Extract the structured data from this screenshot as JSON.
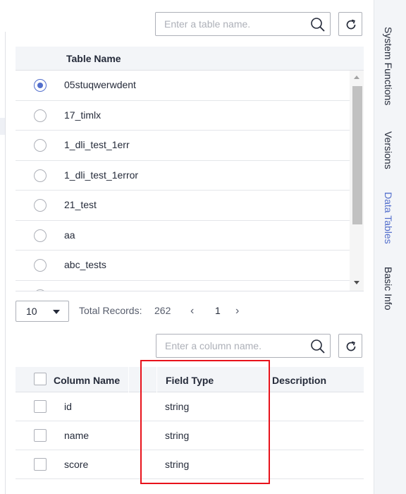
{
  "table_search": {
    "placeholder": "Enter a table name."
  },
  "tables": {
    "header": "Table Name",
    "rows": [
      {
        "name": "05stuqwerwdent",
        "selected": true
      },
      {
        "name": "17_timlx",
        "selected": false
      },
      {
        "name": "1_dli_test_1err",
        "selected": false
      },
      {
        "name": "1_dli_test_1error",
        "selected": false
      },
      {
        "name": "21_test",
        "selected": false
      },
      {
        "name": "aa",
        "selected": false
      },
      {
        "name": "abc_tests",
        "selected": false
      }
    ]
  },
  "pagination": {
    "page_size": "10",
    "total_label": "Total Records:",
    "total_value": "262",
    "prev": "‹",
    "page": "1",
    "next": "›"
  },
  "column_search": {
    "placeholder": "Enter a column name."
  },
  "columns": {
    "headers": {
      "name": "Column Name",
      "type": "Field Type",
      "description": "Description"
    },
    "rows": [
      {
        "name": "id",
        "type": "string",
        "description": ""
      },
      {
        "name": "name",
        "type": "string",
        "description": ""
      },
      {
        "name": "score",
        "type": "string",
        "description": ""
      }
    ]
  },
  "side_tabs": [
    {
      "label": "System Functions",
      "active": false
    },
    {
      "label": "Versions",
      "active": false
    },
    {
      "label": "Data Tables",
      "active": true
    },
    {
      "label": "Basic Info",
      "active": false
    }
  ],
  "colors": {
    "accent": "#526ecc",
    "highlight": "#e8121b"
  }
}
